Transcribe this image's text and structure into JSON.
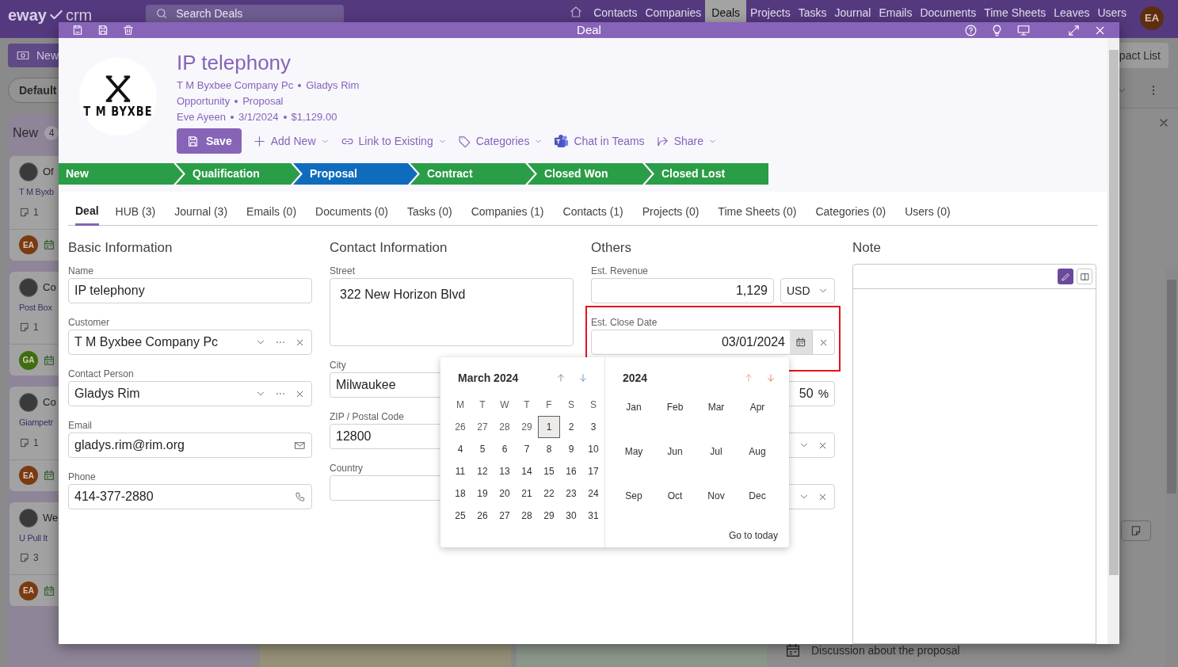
{
  "app": {
    "logo": "eway",
    "logo_suffix": "crm",
    "search_placeholder": "Search Deals",
    "avatar": "EA",
    "nav": [
      {
        "label": "Contacts",
        "selected": false
      },
      {
        "label": "Companies",
        "selected": false
      },
      {
        "label": "Deals",
        "selected": true
      },
      {
        "label": "Projects",
        "selected": false
      },
      {
        "label": "Tasks",
        "selected": false
      },
      {
        "label": "Journal",
        "selected": false
      },
      {
        "label": "Emails",
        "selected": false
      },
      {
        "label": "Documents",
        "selected": false
      },
      {
        "label": "Time Sheets",
        "selected": false
      },
      {
        "label": "Leaves",
        "selected": false
      },
      {
        "label": "Users",
        "selected": false
      }
    ]
  },
  "board": {
    "new_button": "New",
    "filter": "Default",
    "column": {
      "title": "New",
      "count": "4",
      "cards": [
        {
          "title": "Of",
          "subtitle": "T M Byxb",
          "notes": "1",
          "avatar": "EA",
          "color": "#7a3a12"
        },
        {
          "title": "Co",
          "subtitle": "Post Box",
          "notes": "1",
          "avatar": "GA",
          "color": "#3f6e10"
        },
        {
          "title": "Co",
          "subtitle": "Giampetr",
          "notes": "1",
          "avatar": "EA",
          "color": "#7a3a12"
        },
        {
          "title": "We",
          "subtitle": "U Pull It",
          "notes": "3",
          "avatar": "EA",
          "color": "#7a3a12"
        }
      ]
    }
  },
  "side_panel": {
    "view_button": "pact List",
    "item_title": "Discussion about the proposal"
  },
  "dialog": {
    "title": "Deal",
    "deal": {
      "name": "IP telephony",
      "logo_text": "T M BYXBE",
      "lines": [
        [
          "T M Byxbee Company Pc",
          "Gladys Rim"
        ],
        [
          "Opportunity",
          "Proposal"
        ],
        [
          "Eve Ayeen",
          "3/1/2024",
          "$1,129.00"
        ]
      ]
    },
    "actions": [
      {
        "label": "Save",
        "kind": "primary"
      },
      {
        "label": "Add New",
        "kind": "menu"
      },
      {
        "label": "Link to Existing",
        "kind": "menu"
      },
      {
        "label": "Categories",
        "kind": "menu"
      },
      {
        "label": "Chat in Teams",
        "kind": "link"
      },
      {
        "label": "Share",
        "kind": "menu"
      }
    ],
    "stages": [
      {
        "label": "New",
        "selected": false
      },
      {
        "label": "Qualification",
        "selected": false
      },
      {
        "label": "Proposal",
        "selected": true
      },
      {
        "label": "Contract",
        "selected": false
      },
      {
        "label": "Closed Won",
        "selected": false
      },
      {
        "label": "Closed Lost",
        "selected": false
      }
    ],
    "tabs": [
      {
        "label": "Deal",
        "selected": true
      },
      {
        "label": "HUB (3)",
        "selected": false
      },
      {
        "label": "Journal (3)",
        "selected": false
      },
      {
        "label": "Emails (0)",
        "selected": false
      },
      {
        "label": "Documents (0)",
        "selected": false
      },
      {
        "label": "Tasks (0)",
        "selected": false
      },
      {
        "label": "Companies (1)",
        "selected": false
      },
      {
        "label": "Contacts (1)",
        "selected": false
      },
      {
        "label": "Projects (0)",
        "selected": false
      },
      {
        "label": "Time Sheets (0)",
        "selected": false
      },
      {
        "label": "Categories (0)",
        "selected": false
      },
      {
        "label": "Users (0)",
        "selected": false
      }
    ],
    "sections": [
      {
        "title": "Basic Information",
        "fields": [
          {
            "kind": "text",
            "label": "Name",
            "value": "IP telephony"
          },
          {
            "kind": "lookup",
            "label": "Customer",
            "value": "T M Byxbee Company Pc"
          },
          {
            "kind": "lookup",
            "label": "Contact Person",
            "value": "Gladys Rim"
          },
          {
            "kind": "email",
            "label": "Email",
            "value": "gladys.rim@rim.org"
          },
          {
            "kind": "phone",
            "label": "Phone",
            "value": "414-377-2880"
          }
        ]
      },
      {
        "title": "Contact Information",
        "fields": [
          {
            "kind": "textarea",
            "label": "Street",
            "value": "322 New Horizon Blvd"
          },
          {
            "kind": "text",
            "label": "City",
            "value": "Milwaukee"
          },
          {
            "kind": "text",
            "label": "ZIP / Postal Code",
            "value": "12800"
          },
          {
            "kind": "text",
            "label": "Country"
          }
        ]
      },
      {
        "title": "Others",
        "fields": [
          {
            "kind": "money",
            "label": "Est. Revenue",
            "value": "1,129",
            "currency": "USD"
          },
          {
            "kind": "date",
            "label": "Est. Close Date",
            "value": "03/01/2024",
            "highlighted": true
          },
          {
            "kind": "percent",
            "value": "50",
            "unit": "%"
          },
          {
            "kind": "select"
          },
          {
            "kind": "select"
          }
        ]
      }
    ],
    "note": {
      "title": "Note",
      "modes": [
        {
          "kind": "edit",
          "selected": true
        },
        {
          "kind": "split",
          "selected": false
        }
      ]
    },
    "calendar": {
      "month_title": "March 2024",
      "year_title": "2024",
      "today_link": "Go to today",
      "weekdays": [
        "M",
        "T",
        "W",
        "T",
        "F",
        "S",
        "S"
      ],
      "days": [
        {
          "day": "26",
          "outside": true,
          "selected": false
        },
        {
          "day": "27",
          "outside": true,
          "selected": false
        },
        {
          "day": "28",
          "outside": true,
          "selected": false
        },
        {
          "day": "29",
          "outside": true,
          "selected": false
        },
        {
          "day": "1",
          "outside": false,
          "selected": true
        },
        {
          "day": "2",
          "outside": false,
          "selected": false
        },
        {
          "day": "3",
          "outside": false,
          "selected": false
        },
        {
          "day": "4",
          "outside": false,
          "selected": false
        },
        {
          "day": "5",
          "outside": false,
          "selected": false
        },
        {
          "day": "6",
          "outside": false,
          "selected": false
        },
        {
          "day": "7",
          "outside": false,
          "selected": false
        },
        {
          "day": "8",
          "outside": false,
          "selected": false
        },
        {
          "day": "9",
          "outside": false,
          "selected": false
        },
        {
          "day": "10",
          "outside": false,
          "selected": false
        },
        {
          "day": "11",
          "outside": false,
          "selected": false
        },
        {
          "day": "12",
          "outside": false,
          "selected": false
        },
        {
          "day": "13",
          "outside": false,
          "selected": false
        },
        {
          "day": "14",
          "outside": false,
          "selected": false
        },
        {
          "day": "15",
          "outside": false,
          "selected": false
        },
        {
          "day": "16",
          "outside": false,
          "selected": false
        },
        {
          "day": "17",
          "outside": false,
          "selected": false
        },
        {
          "day": "18",
          "outside": false,
          "selected": false
        },
        {
          "day": "19",
          "outside": false,
          "selected": false
        },
        {
          "day": "20",
          "outside": false,
          "selected": false
        },
        {
          "day": "21",
          "outside": false,
          "selected": false
        },
        {
          "day": "22",
          "outside": false,
          "selected": false
        },
        {
          "day": "23",
          "outside": false,
          "selected": false
        },
        {
          "day": "24",
          "outside": false,
          "selected": false
        },
        {
          "day": "25",
          "outside": false,
          "selected": false
        },
        {
          "day": "26",
          "outside": false,
          "selected": false
        },
        {
          "day": "27",
          "outside": false,
          "selected": false
        },
        {
          "day": "28",
          "outside": false,
          "selected": false
        },
        {
          "day": "29",
          "outside": false,
          "selected": false
        },
        {
          "day": "30",
          "outside": false,
          "selected": false
        },
        {
          "day": "31",
          "outside": false,
          "selected": false
        }
      ],
      "months": [
        {
          "label": "Jan",
          "selected": false
        },
        {
          "label": "Feb",
          "selected": false
        },
        {
          "label": "Mar",
          "selected": false
        },
        {
          "label": "Apr",
          "selected": false
        },
        {
          "label": "May",
          "selected": false
        },
        {
          "label": "Jun",
          "selected": false
        },
        {
          "label": "Jul",
          "selected": false
        },
        {
          "label": "Aug",
          "selected": false
        },
        {
          "label": "Sep",
          "selected": false
        },
        {
          "label": "Oct",
          "selected": false
        },
        {
          "label": "Nov",
          "selected": false
        },
        {
          "label": "Dec",
          "selected": false
        }
      ]
    }
  }
}
